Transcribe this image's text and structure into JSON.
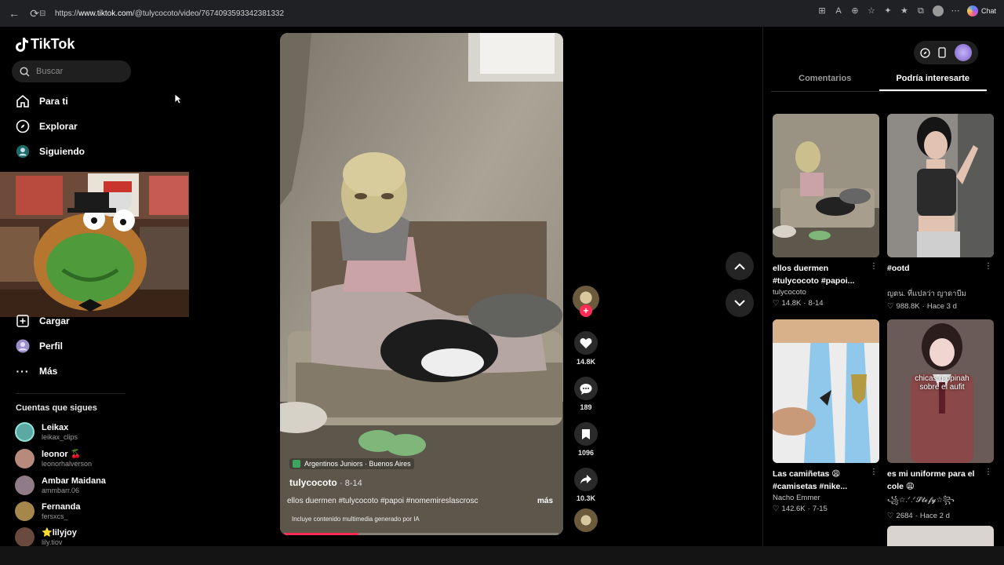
{
  "browser": {
    "url_prefix": "https://",
    "url_host": "www.tiktok.com",
    "url_path": "/@tulycocoto/video/7674093593342381332",
    "chat_label": "Chat"
  },
  "sidebar": {
    "logo_text": "TikTok",
    "search_placeholder": "Buscar",
    "nav": [
      {
        "label": "Para ti",
        "icon": "home-icon"
      },
      {
        "label": "Explorar",
        "icon": "compass-icon"
      },
      {
        "label": "Siguiendo",
        "icon": "following-icon"
      },
      {
        "label": "Cargar",
        "icon": "upload-icon"
      },
      {
        "label": "Perfil",
        "icon": "profile-icon"
      },
      {
        "label": "Más",
        "icon": "more-icon"
      }
    ],
    "following_title": "Cuentas que sigues",
    "following": [
      {
        "name": "Leikax",
        "handle": "leikax_clips",
        "color": "#5aa9a2"
      },
      {
        "name": "leonor 🍒",
        "handle": "leonorhalverson",
        "color": "#b88a7c"
      },
      {
        "name": "Ambar Maidana",
        "handle": "ammbarr.06",
        "color": "#8f7c86"
      },
      {
        "name": "Fernanda",
        "handle": "fersxcs_",
        "color": "#a5874b"
      },
      {
        "name": "⭐lilyjoy",
        "handle": "lily.tiov",
        "color": "#6a4a3e"
      }
    ]
  },
  "video": {
    "location": "Argentinos Juniors · Buenos Aires",
    "author": "tulycocoto",
    "date": "· 8-14",
    "description": "ellos duermen #tulycocoto #papoi #nomemireslascrosc",
    "more": "más",
    "ai_notice": "Incluye contenido multimedia generado por IA",
    "progress": 0.27
  },
  "actions": {
    "likes": "14.8K",
    "comments": "189",
    "saves": "1096",
    "shares": "10.3K"
  },
  "right_panel": {
    "tabs": [
      "Comentarios",
      "Podría interesarte"
    ],
    "active_tab": 1,
    "cards": [
      {
        "title": "ellos duermen #tulycocoto #papoi...",
        "author": "tulycocoto",
        "views": "14.8K",
        "date": "8-14"
      },
      {
        "title": "#ootd",
        "author": "ญดน. ที่แปลว่า ญาดาบีม",
        "views": "988.8K",
        "date": "Hace 3 d"
      },
      {
        "title": "Las camiñetas 😩 #camisetas #nike...",
        "author": "Nacho Emmer",
        "views": "142.6K",
        "date": "7-15"
      },
      {
        "title": "es mi uniforme para el cole 😩",
        "author": "꧁☆.ᐟ.ᐟ𝓢𝓽𝓮𝓯𝔂☆꧂",
        "views": "2684",
        "date": "Hace 2 d",
        "overlay": "chicas q opinah sobre el aufit"
      }
    ]
  }
}
